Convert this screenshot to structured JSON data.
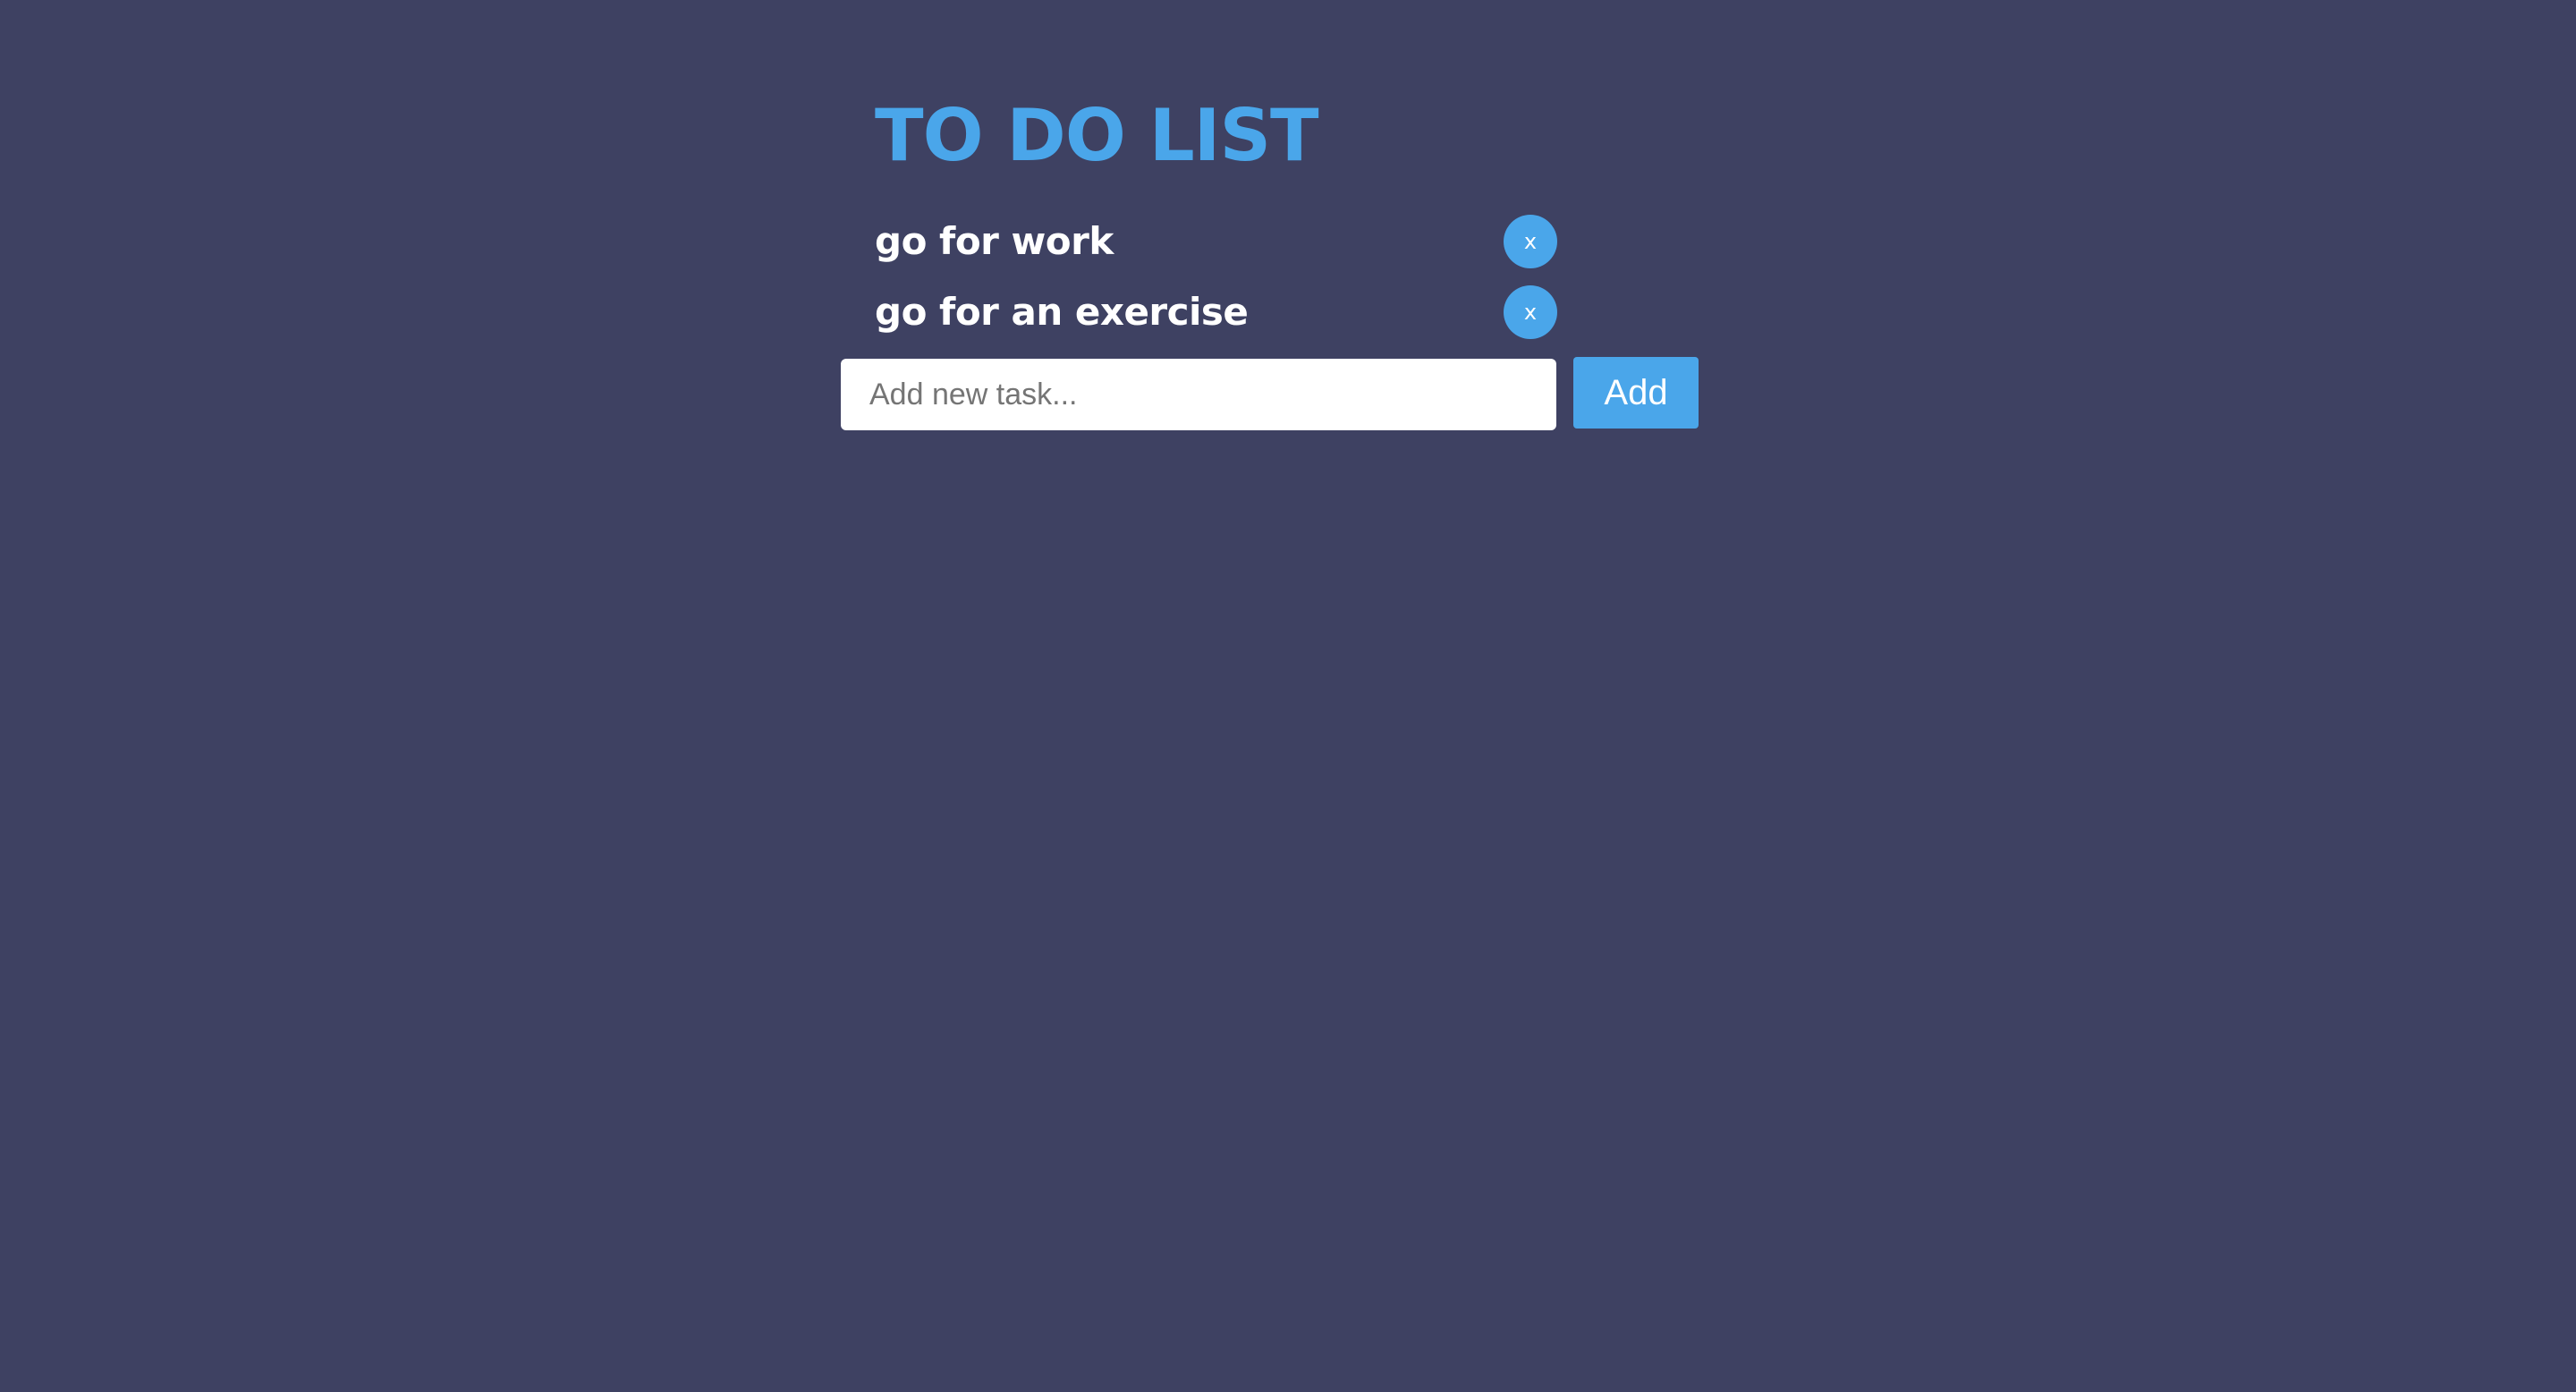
{
  "app": {
    "title": "TO DO LIST",
    "colors": {
      "background": "#3e4162",
      "accent": "#4aa6ea",
      "task_text": "#ffffff"
    }
  },
  "tasks": [
    {
      "label": "go for work",
      "delete_label": "x",
      "delete_icon": "close-icon"
    },
    {
      "label": "go for an exercise",
      "delete_label": "x",
      "delete_icon": "close-icon"
    }
  ],
  "new_task": {
    "placeholder": "Add new task...",
    "value": "",
    "add_label": "Add"
  }
}
